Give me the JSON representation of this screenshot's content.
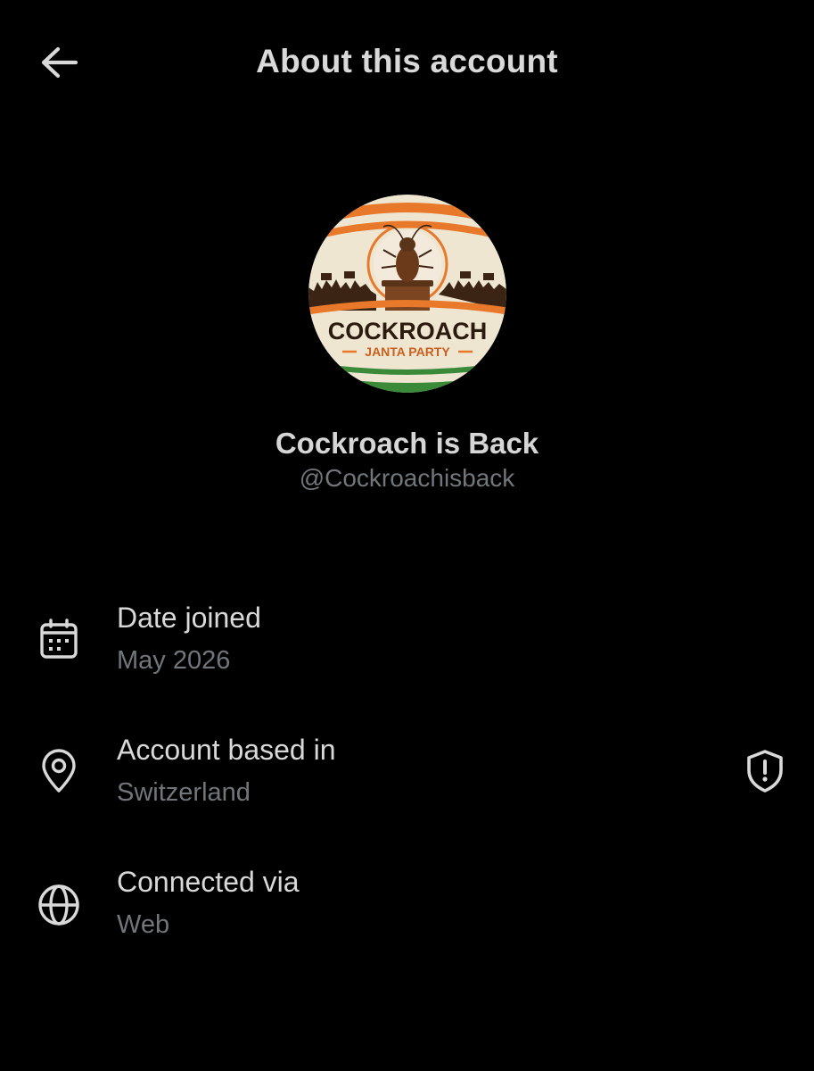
{
  "header": {
    "title": "About this account",
    "back_icon": "arrow-left-icon"
  },
  "profile": {
    "display_name": "Cockroach is Back",
    "handle": "@Cockroachisback",
    "avatar": {
      "logo_line1": "COCKROACH",
      "logo_line2": "JANTA PARTY",
      "colors": {
        "saffron": "#e8792b",
        "green": "#3a8a3a",
        "cream": "#efe6d2",
        "brown": "#5a3418"
      }
    }
  },
  "details": [
    {
      "icon": "calendar-icon",
      "label": "Date joined",
      "value": "May 2026"
    },
    {
      "icon": "location-pin-icon",
      "label": "Account based in",
      "value": "Switzerland",
      "badge_icon": "shield-alert-icon"
    },
    {
      "icon": "globe-icon",
      "label": "Connected via",
      "value": "Web"
    }
  ],
  "colors": {
    "background": "#000000",
    "primary_text": "#d9d9d9",
    "secondary_text": "#71767b"
  }
}
